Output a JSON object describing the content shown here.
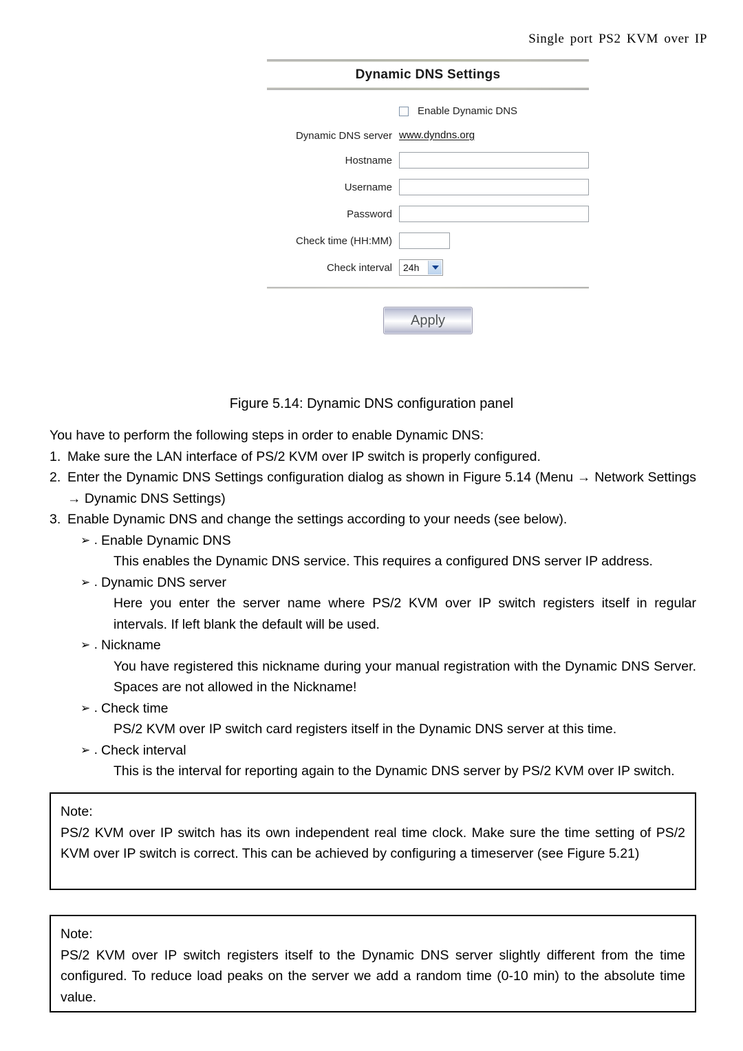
{
  "running_head": "Single port PS2 KVM over IP",
  "panel": {
    "title": "Dynamic DNS Settings",
    "enable_checkbox_label": "Enable Dynamic DNS",
    "fields": [
      {
        "label": "Dynamic DNS server",
        "value": "www.dyndns.org",
        "type": "link"
      },
      {
        "label": "Hostname",
        "value": "",
        "type": "text"
      },
      {
        "label": "Username",
        "value": "",
        "type": "text"
      },
      {
        "label": "Password",
        "value": "",
        "type": "text"
      },
      {
        "label": "Check time (HH:MM)",
        "value": "",
        "type": "text-small"
      },
      {
        "label": "Check interval",
        "value": "24h",
        "type": "select"
      }
    ],
    "apply_label": "Apply",
    "accent_colors": {
      "checkbox_border": "#7f93a9",
      "dropdown_arrow": "#12418f",
      "rule": "#b9b9b7"
    }
  },
  "figure_caption": "Figure 5.14: Dynamic DNS configuration panel",
  "intro": "You have to perform the following steps in order to enable Dynamic DNS:",
  "steps": [
    {
      "num": "1.",
      "text": "Make sure the LAN interface of PS/2 KVM over IP switch is properly configured."
    },
    {
      "num": "2.",
      "text": "Enter the Dynamic DNS Settings configuration dialog as shown in Figure 5.14 (Menu → Network Settings → Dynamic DNS Settings)"
    },
    {
      "num": "3.",
      "text": "Enable Dynamic DNS and change the settings according to your needs (see below)."
    }
  ],
  "bullet_marker": "➢ .",
  "bullets": [
    {
      "title": "Enable Dynamic DNS",
      "desc": "This enables the Dynamic DNS service. This requires a configured DNS server IP address."
    },
    {
      "title": "Dynamic DNS server",
      "desc": "Here you enter the server name where PS/2 KVM over IP switch registers itself in regular intervals. If left blank the default will be used."
    },
    {
      "title": "Nickname",
      "desc": "You have registered this nickname during your manual registration with the Dynamic DNS Server. Spaces are not allowed in the Nickname!"
    },
    {
      "title": "Check time",
      "desc": "PS/2 KVM over IP switch card registers itself in the Dynamic DNS server at this time."
    },
    {
      "title": "Check interval",
      "desc": "This is the interval for reporting again to the Dynamic DNS server by PS/2 KVM over IP switch."
    }
  ],
  "notes": [
    {
      "label": "Note:",
      "text": "PS/2 KVM over IP switch has its own independent real time clock. Make sure the time setting of PS/2 KVM over IP switch is correct. This can be achieved by configuring a timeserver (see Figure 5.21)"
    },
    {
      "label": "Note:",
      "text": "PS/2 KVM over IP switch registers itself to the Dynamic DNS server slightly different from the time configured. To reduce load peaks on the server we add a random time (0-10 min) to the absolute time value."
    }
  ]
}
